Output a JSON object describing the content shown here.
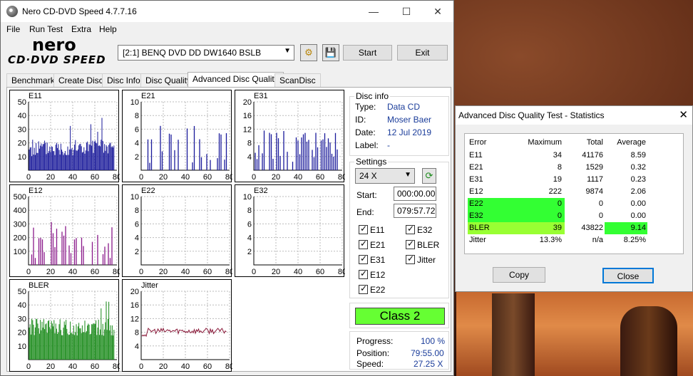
{
  "main_window": {
    "title": "Nero CD-DVD Speed 4.7.7.16",
    "minimize": "—",
    "maximize": "☐",
    "close": "✕",
    "menu": [
      "File",
      "Run Test",
      "Extra",
      "Help"
    ],
    "logo_top": "nero",
    "logo_bottom": "CD·DVD SPEED",
    "drive": "[2:1]   BENQ DVD DD DW1640 BSLB",
    "start_button": "Start",
    "exit_button": "Exit",
    "tabs": [
      "Benchmark",
      "Create Disc",
      "Disc Info",
      "Disc Quality",
      "Advanced Disc Quality",
      "ScanDisc"
    ],
    "active_tab": "Advanced Disc Quality"
  },
  "disc_info": {
    "group_title": "Disc info",
    "type_label": "Type:",
    "type_value": "Data CD",
    "id_label": "ID:",
    "id_value": "Moser Baer",
    "date_label": "Date:",
    "date_value": "12 Jul 2019",
    "label_label": "Label:",
    "label_value": "-"
  },
  "settings": {
    "group_title": "Settings",
    "speed": "24 X",
    "start_label": "Start:",
    "start_value": "000:00.00",
    "end_label": "End:",
    "end_value": "079:57.72",
    "checks": [
      "E11",
      "E32",
      "E21",
      "BLER",
      "E31",
      "Jitter",
      "E12",
      "E22"
    ]
  },
  "class_label": "Class 2",
  "progress": {
    "progress_label": "Progress:",
    "progress_value": "100 %",
    "position_label": "Position:",
    "position_value": "79:55.00",
    "speed_label": "Speed:",
    "speed_value": "27.25 X"
  },
  "charts": [
    {
      "name": "E11",
      "yticks": [
        "50",
        "40",
        "30",
        "20",
        "10"
      ],
      "xticks": [
        "0",
        "20",
        "40",
        "60",
        "80"
      ],
      "color": "#1a1a9a"
    },
    {
      "name": "E21",
      "yticks": [
        "10",
        "8",
        "6",
        "4",
        "2"
      ],
      "xticks": [
        "0",
        "20",
        "40",
        "60",
        "80"
      ],
      "color": "#1a1a9a"
    },
    {
      "name": "E31",
      "yticks": [
        "20",
        "16",
        "12",
        "8",
        "4"
      ],
      "xticks": [
        "0",
        "20",
        "40",
        "60",
        "80"
      ],
      "color": "#1a1a9a"
    },
    {
      "name": "E12",
      "yticks": [
        "500",
        "400",
        "300",
        "200",
        "100"
      ],
      "xticks": [
        "0",
        "20",
        "40",
        "60",
        "80"
      ],
      "color": "#8a1a8a"
    },
    {
      "name": "E22",
      "yticks": [
        "10",
        "8",
        "6",
        "4",
        "2"
      ],
      "xticks": [
        "0",
        "20",
        "40",
        "60",
        "80"
      ],
      "color": "#1a1a9a"
    },
    {
      "name": "E32",
      "yticks": [
        "10",
        "8",
        "6",
        "4",
        "2"
      ],
      "xticks": [
        "0",
        "20",
        "40",
        "60",
        "80"
      ],
      "color": "#1a1a9a"
    },
    {
      "name": "BLER",
      "yticks": [
        "50",
        "40",
        "30",
        "20",
        "10"
      ],
      "xticks": [
        "0",
        "20",
        "40",
        "60",
        "80"
      ],
      "color": "#1a8a1a"
    },
    {
      "name": "Jitter",
      "yticks": [
        "20",
        "16",
        "12",
        "8",
        "4"
      ],
      "xticks": [
        "0",
        "20",
        "40",
        "60",
        "80"
      ],
      "color": "#8a1a3a"
    }
  ],
  "stats_dialog": {
    "title": "Advanced Disc Quality Test - Statistics",
    "close": "✕",
    "headers": [
      "Error",
      "Maximum",
      "Total",
      "Average"
    ],
    "rows": [
      [
        "E11",
        "34",
        "41176",
        "8.59"
      ],
      [
        "E21",
        "8",
        "1529",
        "0.32"
      ],
      [
        "E31",
        "19",
        "1117",
        "0.23"
      ],
      [
        "E12",
        "222",
        "9874",
        "2.06"
      ],
      [
        "E22",
        "0",
        "0",
        "0.00"
      ],
      [
        "E32",
        "0",
        "0",
        "0.00"
      ],
      [
        "BLER",
        "39",
        "43822",
        "9.14"
      ],
      [
        "Jitter",
        "13.3%",
        "n/a",
        "8.25%"
      ]
    ],
    "copy_button": "Copy",
    "close_button": "Close",
    "colors": {
      "highlight_green": "#33ff33",
      "highlight_yellow": "#99ff33"
    }
  }
}
